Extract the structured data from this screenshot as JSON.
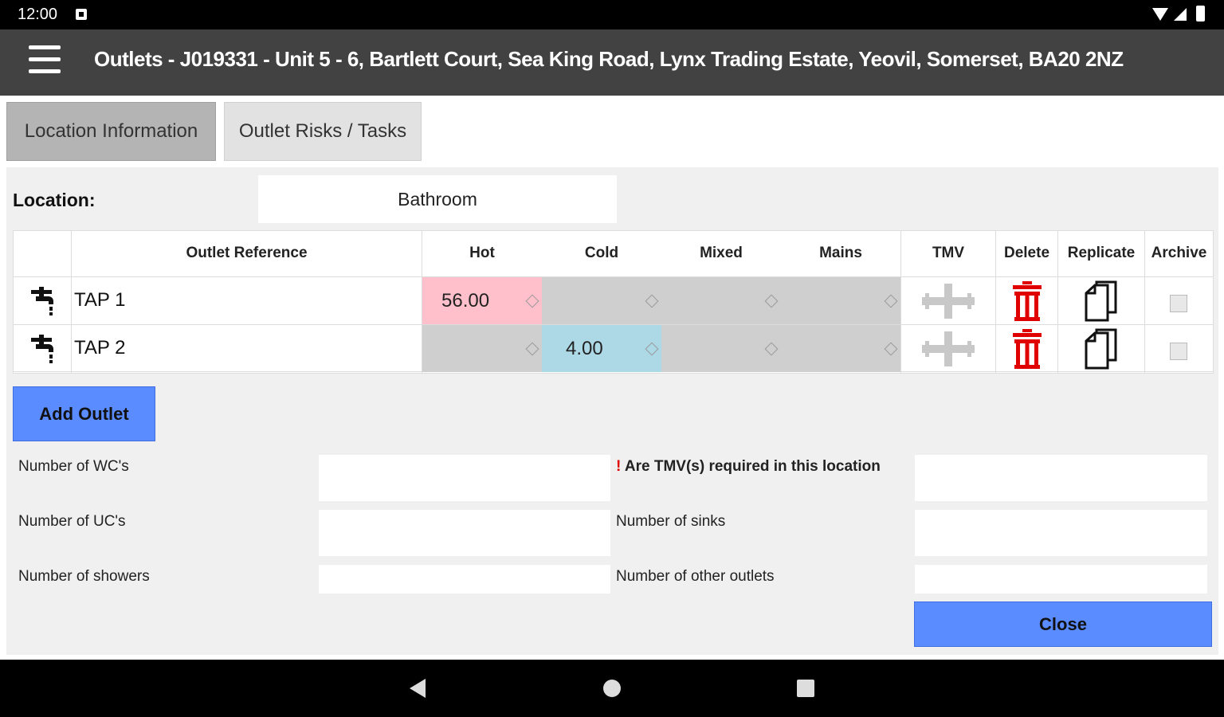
{
  "status_bar": {
    "time": "12:00"
  },
  "app_bar": {
    "title": "Outlets - J019331 - Unit 5 - 6, Bartlett Court, Sea King Road, Lynx Trading Estate, Yeovil, Somerset, BA20 2NZ",
    "menu_icon": "hamburger-menu-icon"
  },
  "tabs": [
    {
      "label": "Location Information",
      "active": true
    },
    {
      "label": "Outlet Risks / Tasks",
      "active": false
    }
  ],
  "location": {
    "label": "Location:",
    "value": "Bathroom"
  },
  "table": {
    "headers": {
      "ref": "Outlet Reference",
      "hot": "Hot",
      "cold": "Cold",
      "mixed": "Mixed",
      "mains": "Mains",
      "tmv": "TMV",
      "delete": "Delete",
      "replicate": "Replicate",
      "archive": "Archive"
    },
    "rows": [
      {
        "ref": "TAP 1",
        "hot": "56.00",
        "cold": "",
        "mixed": "",
        "mains": "",
        "archived": false
      },
      {
        "ref": "TAP 2",
        "hot": "",
        "cold": "4.00",
        "mixed": "",
        "mains": "",
        "archived": false
      }
    ]
  },
  "buttons": {
    "add_outlet": "Add Outlet",
    "close": "Close"
  },
  "fields": {
    "wcs": {
      "label": "Number of WC's",
      "value": ""
    },
    "ucs": {
      "label": "Number of UC's",
      "value": ""
    },
    "showers": {
      "label": "Number of showers",
      "value": ""
    },
    "tmv_required": {
      "marker": "!",
      "label": "Are TMV(s) required in this location",
      "value": ""
    },
    "sinks": {
      "label": "Number of sinks",
      "value": ""
    },
    "other_outlets": {
      "label": "Number of other outlets",
      "value": ""
    }
  },
  "colors": {
    "hot_cell": "#ffc0cb",
    "cold_cell": "#add8e6",
    "button": "#5a8cff",
    "delete_icon": "#e00000",
    "app_bar": "#424242"
  }
}
